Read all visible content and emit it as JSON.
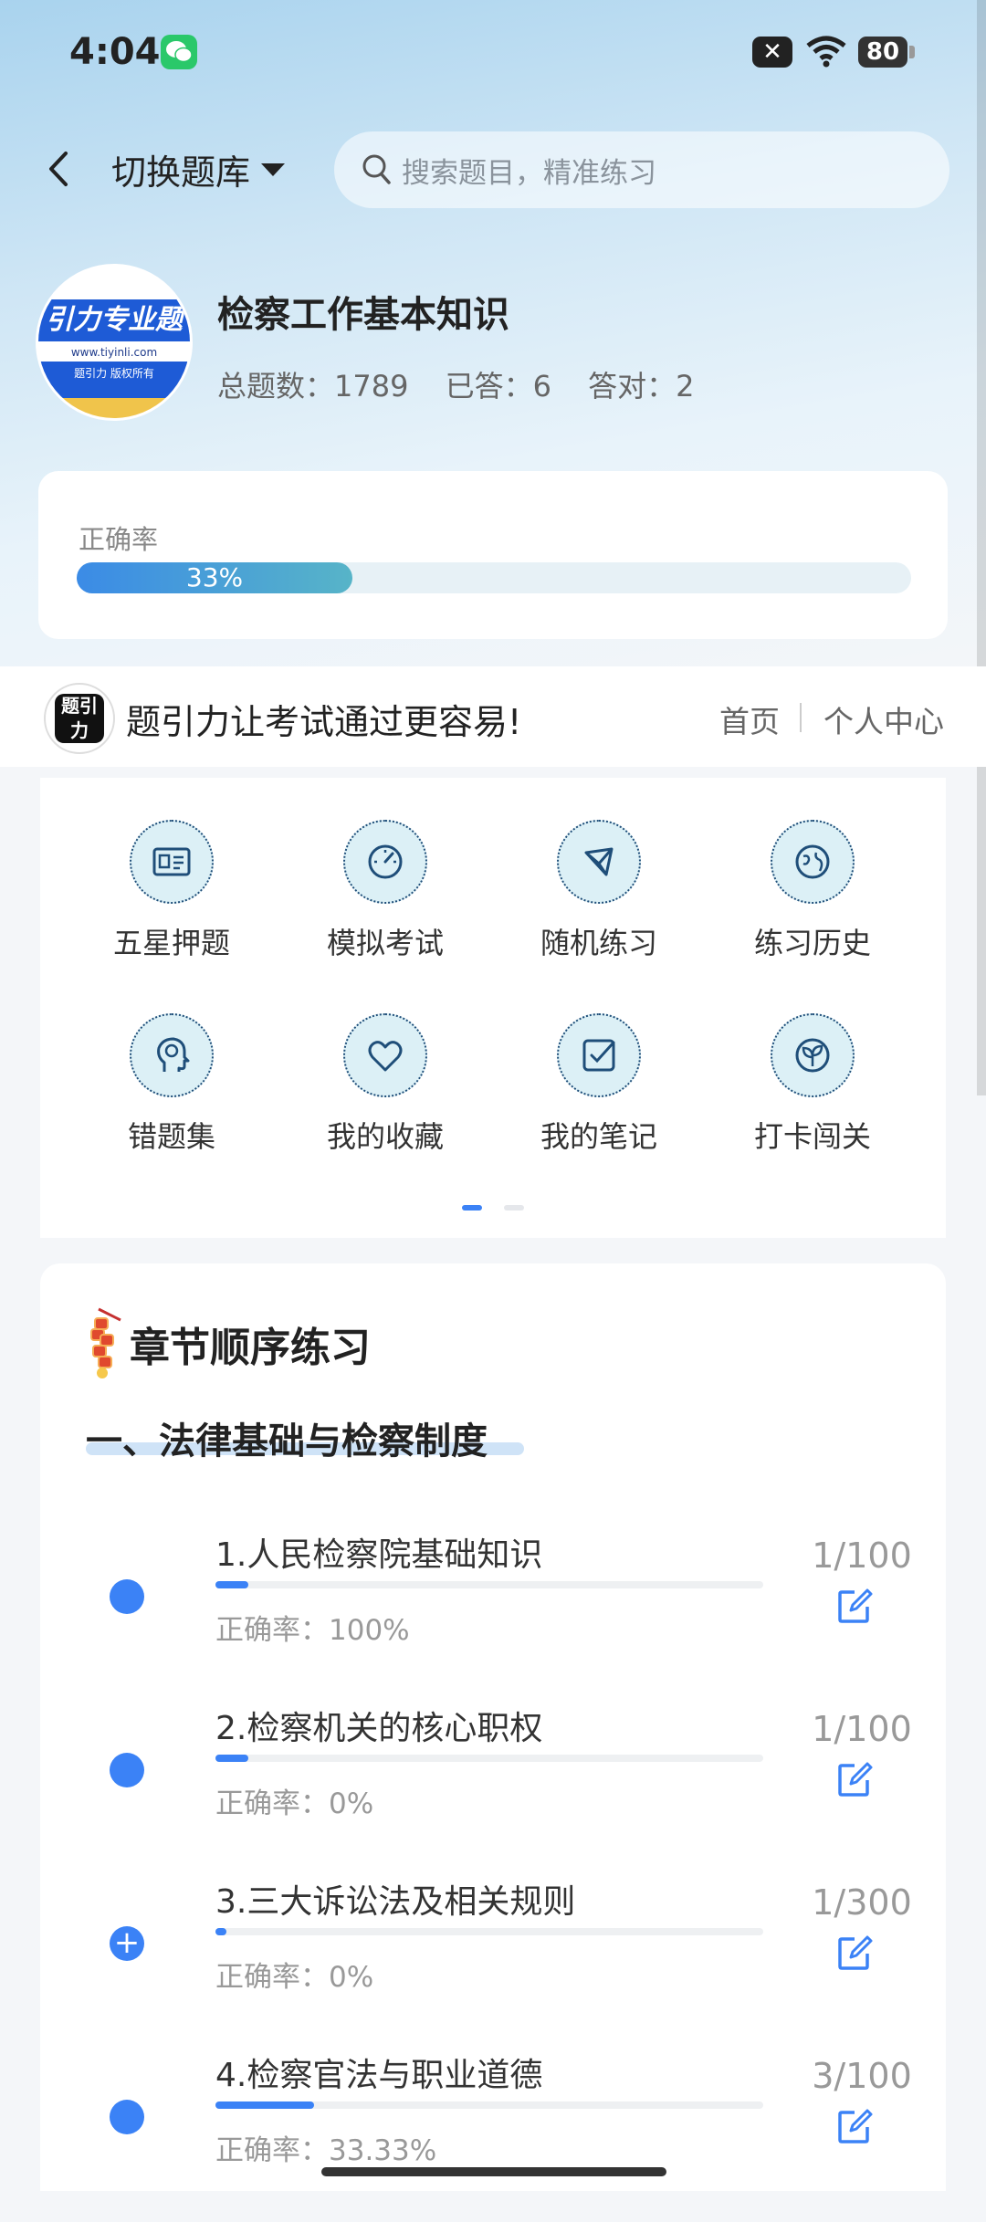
{
  "status_bar": {
    "time": "4:04",
    "battery": "80"
  },
  "header": {
    "switch_label": "切换题库",
    "search_placeholder": "搜索题目，精准练习"
  },
  "bank": {
    "logo_text": "引力专业题",
    "logo_url_text": "www.tiyinli.com",
    "logo_copyright": "题引力 版权所有",
    "title": "检察工作基本知识",
    "total_label": "总题数：1789",
    "answered_label": "已答：6",
    "correct_label": "答对：2"
  },
  "accuracy": {
    "label": "正确率",
    "value_text": "33%",
    "value": 0.33
  },
  "brand": {
    "logo_text": "题引力",
    "slogan": "题引力让考试通过更容易!",
    "home": "首页",
    "user_center": "个人中心"
  },
  "grid": {
    "items": [
      {
        "label": "五星押题",
        "icon": "id-card-icon"
      },
      {
        "label": "模拟考试",
        "icon": "speedometer-icon"
      },
      {
        "label": "随机练习",
        "icon": "network-icon"
      },
      {
        "label": "练习历史",
        "icon": "globe-icon"
      },
      {
        "label": "错题集",
        "icon": "brain-head-icon"
      },
      {
        "label": "我的收藏",
        "icon": "heart-icon"
      },
      {
        "label": "我的笔记",
        "icon": "note-check-icon"
      },
      {
        "label": "打卡闯关",
        "icon": "sprout-icon"
      }
    ]
  },
  "chapters": {
    "section_title": "章节顺序练习",
    "part_title": "一、法律基础与检察制度",
    "items": [
      {
        "name": "1.人民检察院基础知识",
        "rate": "正确率：100%",
        "count": "1/100",
        "progress": 0.01,
        "expanded": false
      },
      {
        "name": "2.检察机关的核心职权",
        "rate": "正确率：0%",
        "count": "1/100",
        "progress": 0.01,
        "expanded": false
      },
      {
        "name": "3.三大诉讼法及相关规则",
        "rate": "正确率：0%",
        "count": "1/300",
        "progress": 0.0033,
        "expanded": true
      },
      {
        "name": "4.检察官法与职业道德",
        "rate": "正确率：33.33%",
        "count": "3/100",
        "progress": 0.03,
        "expanded": false
      }
    ]
  },
  "colors": {
    "accent": "#3b82f6",
    "icon_stroke": "#1f4e79"
  }
}
